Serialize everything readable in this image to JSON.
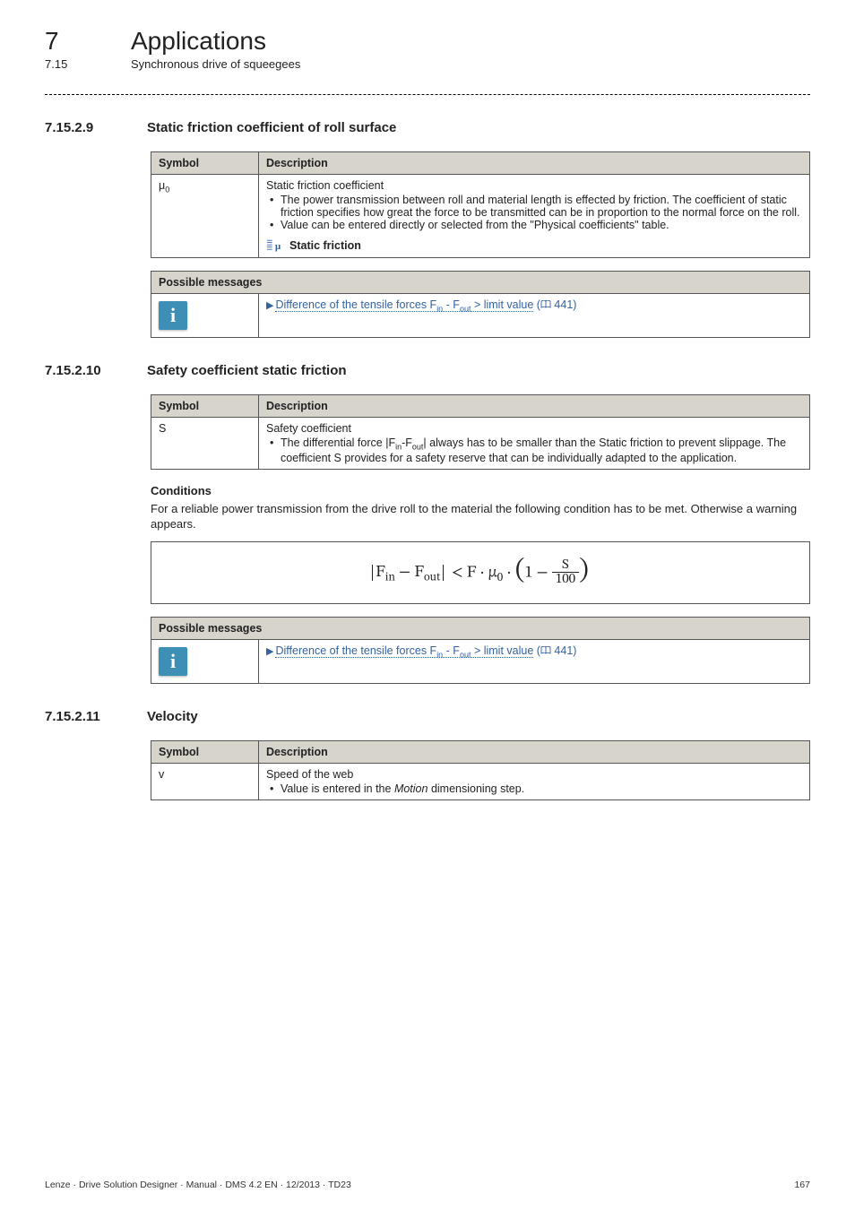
{
  "header": {
    "chapter_num": "7",
    "chapter_title": "Applications",
    "section_num": "7.15",
    "section_title": "Synchronous drive of squeegees"
  },
  "sections": [
    {
      "num": "7.15.2.9",
      "title": "Static friction coefficient of roll surface",
      "table": {
        "headers": {
          "symbol": "Symbol",
          "description": "Description"
        },
        "rows": [
          {
            "symbol": "μ",
            "symbol_sub": "0",
            "title": "Static friction coefficient",
            "bullets": [
              "The power transmission between roll and material length is effected by friction. The coefficient of static friction specifies how great the force to be transmitted can be in proportion to the normal force on the roll.",
              "Value can be entered directly or selected from the \"Physical coefficients\" table."
            ],
            "footer_label": "Static friction"
          }
        ]
      },
      "messages": {
        "header": "Possible messages",
        "link_prefix": "Difference of the tensile forces F",
        "link_sub1": "in",
        "link_mid": " - F",
        "link_sub2": "out",
        "link_suffix": " > limit value",
        "page_ref": " 441)"
      }
    },
    {
      "num": "7.15.2.10",
      "title": "Safety coefficient static friction",
      "table": {
        "headers": {
          "symbol": "Symbol",
          "description": "Description"
        },
        "rows": [
          {
            "symbol": "S",
            "title": "Safety coefficient",
            "bullets_html": "The differential force |F<sub>in</sub>-F<sub>out</sub>| always has to be smaller than the Static friction to prevent slippage. The coefficient S provides for a safety reserve that can be individually adapted to the application."
          }
        ]
      },
      "conditions_heading": "Conditions",
      "conditions_para": "For a reliable power transmission from the drive roll to the material the following condition has to be met. Otherwise a warning appears.",
      "messages": {
        "header": "Possible messages",
        "link_prefix": "Difference of the tensile forces F",
        "link_sub1": "in",
        "link_mid": " - F",
        "link_sub2": "out",
        "link_suffix": " > limit value",
        "page_ref": " 441)"
      }
    },
    {
      "num": "7.15.2.11",
      "title": "Velocity",
      "table": {
        "headers": {
          "symbol": "Symbol",
          "description": "Description"
        },
        "rows": [
          {
            "symbol": "v",
            "title": "Speed of the web",
            "bullets_html": "Value is entered in the <i>Motion</i> dimensioning step."
          }
        ]
      }
    }
  ],
  "footer": {
    "left": "Lenze · Drive Solution Designer · Manual · DMS 4.2 EN · 12/2013 · TD23",
    "right": "167"
  }
}
